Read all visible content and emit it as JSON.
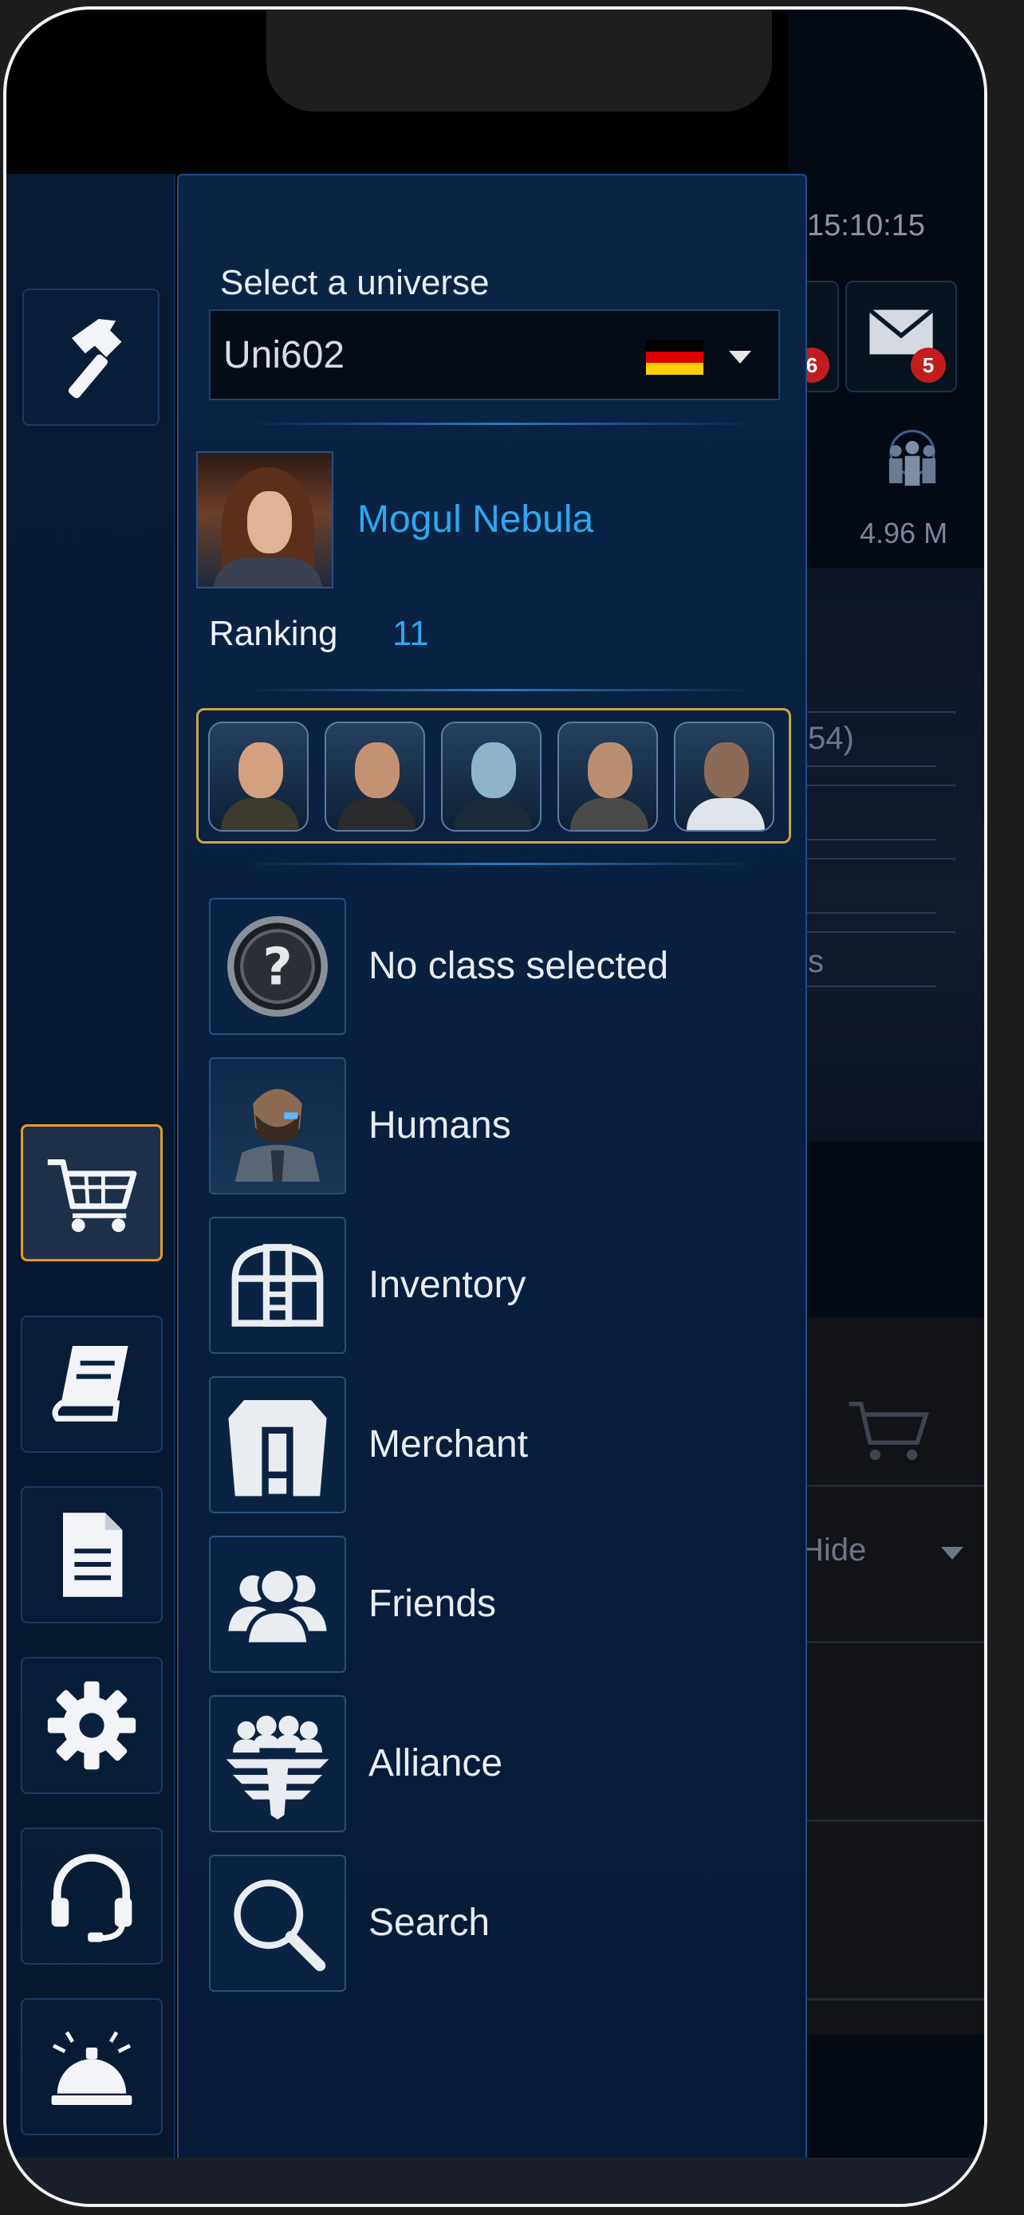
{
  "status": {
    "time": "15:10:15"
  },
  "background": {
    "notification_badge_left": "6",
    "mail_badge": "5",
    "population": "4.96 M",
    "slot_texts": [
      "54)",
      "",
      "",
      "s"
    ],
    "hide_label": "Hide"
  },
  "universe": {
    "label": "Select a universe",
    "value": "Uni602",
    "flag_colors": [
      "#000000",
      "#dd0000",
      "#ffce00"
    ]
  },
  "player": {
    "name": "Mogul Nebula",
    "ranking_label": "Ranking",
    "ranking_value": "11"
  },
  "rail": [
    "hammer-icon",
    "cart-icon",
    "book-icon",
    "document-icon",
    "gear-icon",
    "headset-icon",
    "service-bell-icon"
  ],
  "menu": [
    {
      "label": "No class selected",
      "icon": "question-icon"
    },
    {
      "label": "Humans",
      "icon": "human-portrait-icon"
    },
    {
      "label": "Inventory",
      "icon": "treasure-chest-icon"
    },
    {
      "label": "Merchant",
      "icon": "merchant-icon"
    },
    {
      "label": "Friends",
      "icon": "friends-icon"
    },
    {
      "label": "Alliance",
      "icon": "alliance-icon"
    },
    {
      "label": "Search",
      "icon": "magnifier-icon"
    }
  ],
  "colors": {
    "accent": "#2ea7f0",
    "active_border": "#e79a21",
    "officer_frame": "#c9a83c"
  }
}
